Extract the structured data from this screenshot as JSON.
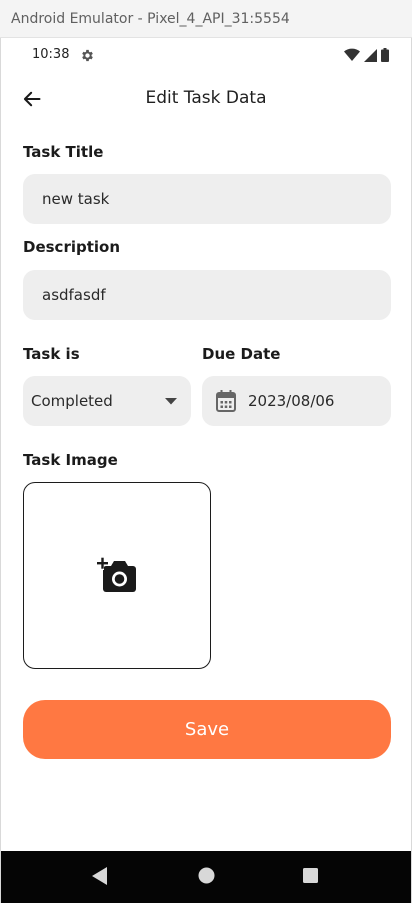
{
  "window": {
    "title": "Android Emulator - Pixel_4_API_31:5554"
  },
  "status_bar": {
    "time": "10:38",
    "icons": [
      "gear-icon",
      "wifi-icon",
      "signal-icon",
      "battery-icon"
    ]
  },
  "app_bar": {
    "title": "Edit Task Data",
    "back_icon": "arrow-back-icon"
  },
  "form": {
    "task_title": {
      "label": "Task Title",
      "value": "new task"
    },
    "description": {
      "label": "Description",
      "value": "asdfasdf"
    },
    "status": {
      "label": "Task is",
      "selected": "Completed",
      "icon": "dropdown-arrow-icon"
    },
    "due_date": {
      "label": "Due Date",
      "value": "2023/08/06",
      "icon": "calendar-icon"
    },
    "image": {
      "label": "Task Image",
      "icon": "add-photo-icon"
    },
    "save_label": "Save"
  },
  "colors": {
    "accent": "#ff7842",
    "field_bg": "#eeeeee",
    "nav_bg": "#050505"
  },
  "nav": {
    "buttons": [
      "back-triangle-icon",
      "home-circle-icon",
      "recents-square-icon"
    ]
  }
}
